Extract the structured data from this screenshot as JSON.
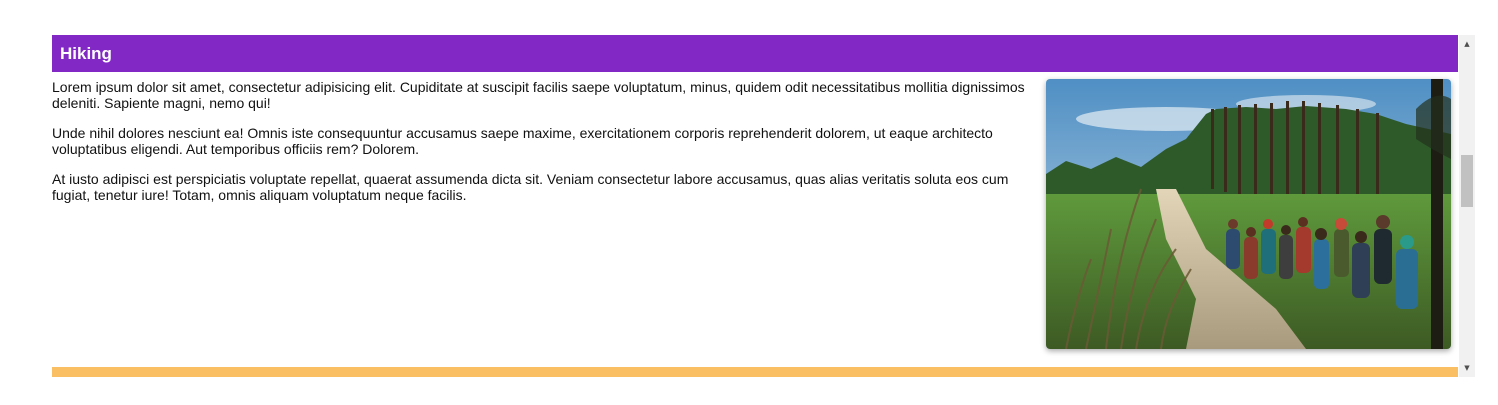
{
  "section": {
    "title": "Hiking",
    "header_color": "#8228c4",
    "next_section_color": "#f9bf62"
  },
  "paragraphs": [
    "Lorem ipsum dolor sit amet, consectetur adipisicing elit. Cupiditate at suscipit facilis saepe voluptatum, minus, quidem odit necessitatibus mollitia dignissimos deleniti. Sapiente magni, nemo qui!",
    "Unde nihil dolores nesciunt ea! Omnis iste consequuntur accusamus saepe maxime, exercitationem corporis reprehenderit dolorem, ut eaque architecto voluptatibus eligendi. Aut temporibus officiis rem? Dolorem.",
    "At iusto adipisci est perspiciatis voluptate repellat, quaerat assumenda dicta sit. Veniam consectetur labore accusamus, quas alias veritatis soluta eos cum fugiat, tenetur iure! Totam, omnis aliquam voluptatum neque facilis."
  ],
  "scrollbar": {
    "up_icon": "triangle-up-icon",
    "down_icon": "triangle-down-icon"
  }
}
